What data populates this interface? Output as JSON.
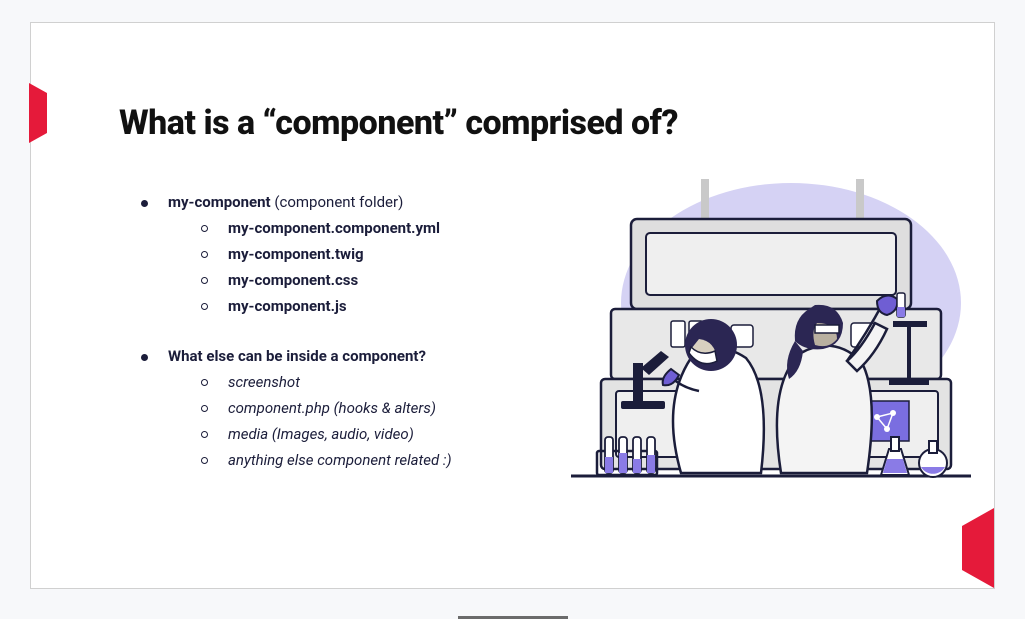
{
  "title": "What is a “component” comprised of?",
  "bullets": [
    {
      "heading_bold": "my-component",
      "heading_rest": " (component folder)",
      "sub_style": "bold",
      "items": [
        "my-component.component.yml",
        "my-component.twig",
        "my-component.css",
        "my-component.js"
      ]
    },
    {
      "heading_bold": "What else can be inside a component?",
      "heading_rest": "",
      "sub_style": "italic",
      "items": [
        "screenshot",
        "component.php (hooks & alters)",
        "media (Images, audio, video)",
        "anything else component related :)"
      ]
    }
  ],
  "accent_color": "#e51a3a",
  "text_color": "#1b1d3a"
}
